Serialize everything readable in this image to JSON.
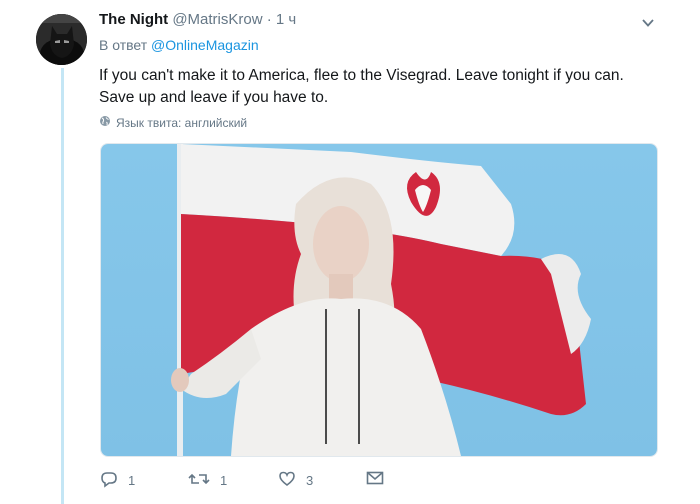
{
  "tweet": {
    "display_name": "The Night",
    "handle": "@MatrisKrow",
    "separator": "·",
    "time": "1 ч",
    "reply_prefix": "В ответ",
    "reply_to": "@OnlineMagazin",
    "text": "If you can't make it to America, flee to the Visegrad. Leave tonight if you can. Save up and leave if you have to.",
    "language": "Язык твита: английский"
  },
  "actions": {
    "reply_count": "1",
    "retweet_count": "1",
    "like_count": "3"
  },
  "colors": {
    "accent": "#1b95e0",
    "muted": "#657786",
    "thread": "#c4e6f5",
    "flag_red": "#d1283f"
  },
  "icons": [
    "chevron-down-icon",
    "globe-icon",
    "reply-icon",
    "retweet-icon",
    "heart-icon",
    "mail-icon"
  ]
}
